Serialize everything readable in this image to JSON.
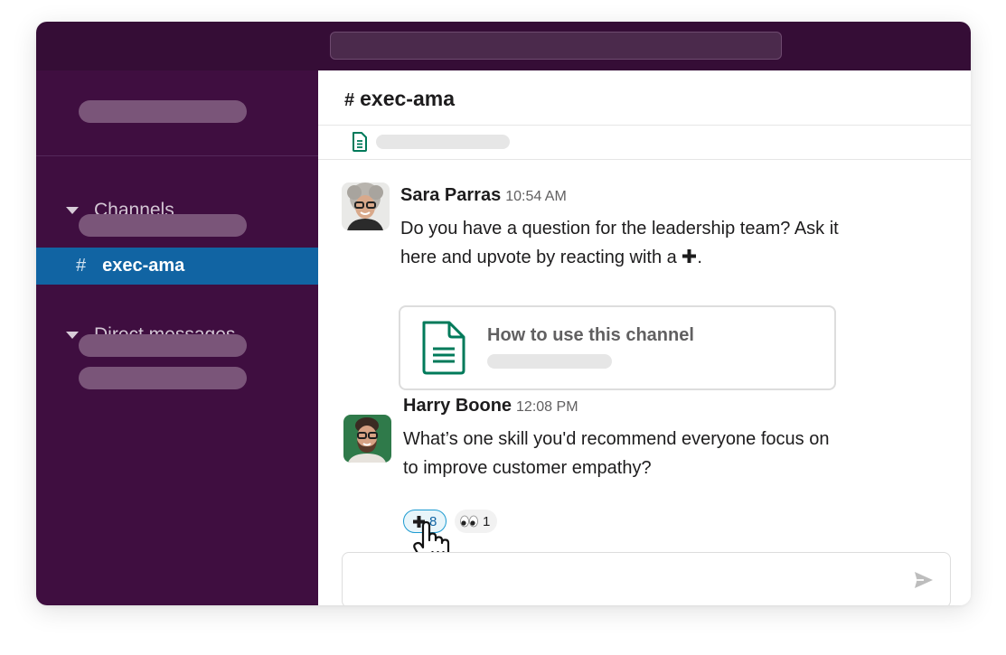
{
  "app": {
    "accent": "#1164a3",
    "sidebar_bg": "#3f0e40",
    "topbar_bg": "#350d36"
  },
  "sidebar": {
    "channels_label": "Channels",
    "active_channel": {
      "hash": "#",
      "name": "exec-ama"
    },
    "dms_label": "Direct messages"
  },
  "channel": {
    "hash": "#",
    "name": "exec-ama"
  },
  "messages": [
    {
      "author": "Sara Parras",
      "time": "10:54 AM",
      "line1": "Do you have a question for the leadership team? Ask it",
      "line2": "here and upvote by reacting with a ",
      "line2_icon": "plus-icon",
      "line2_end": ".",
      "attachment": {
        "title": "How to use this channel",
        "icon": "document-icon"
      }
    },
    {
      "author": "Harry Boone",
      "time": "12:08 PM",
      "line1": "What’s one skill you'd recommend everyone focus on",
      "line2": "to improve customer empathy?",
      "reactions": [
        {
          "emoji": "plus-icon",
          "count": "8",
          "active": true
        },
        {
          "emoji": "eyes-emoji",
          "count": "1",
          "active": false
        }
      ]
    }
  ],
  "composer": {
    "send_icon": "send-icon"
  }
}
